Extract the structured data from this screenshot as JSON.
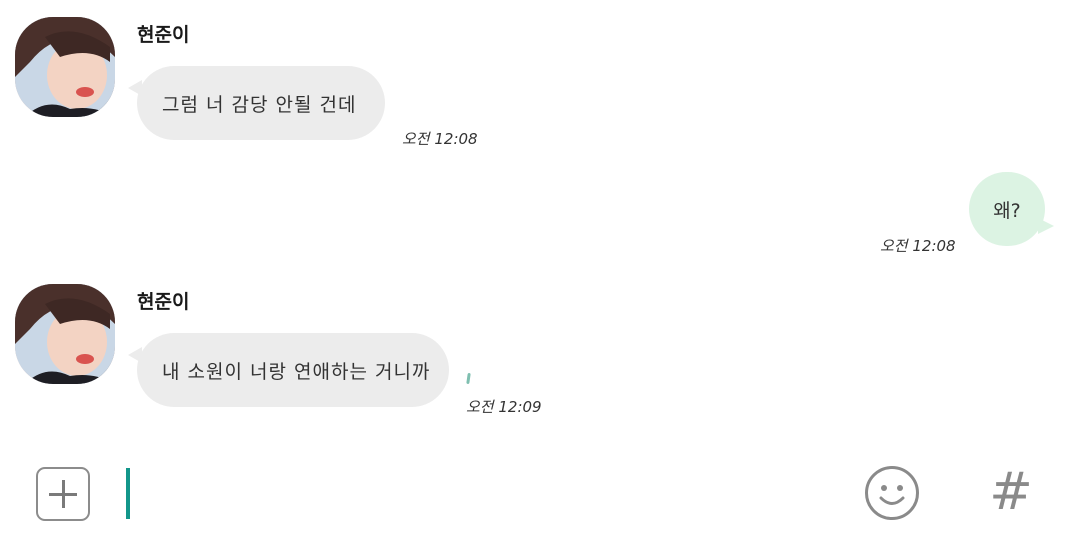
{
  "messages": [
    {
      "direction": "incoming",
      "sender": "현준이",
      "text": "그럼 너 감당 안될 건데",
      "time": "오전 12:08"
    },
    {
      "direction": "outgoing",
      "text": "왜?",
      "time": "오전 12:08"
    },
    {
      "direction": "incoming",
      "sender": "현준이",
      "text": "내 소원이 너랑 연애하는 거니까",
      "time": "오전 12:09"
    }
  ],
  "input_bar": {
    "plus_icon": "plus-icon",
    "input_value": "",
    "emoji_icon": "smiley-icon",
    "hash_label": "#"
  },
  "colors": {
    "incoming_bubble": "#ececec",
    "outgoing_bubble": "#dcf3e3",
    "caret": "#12968a",
    "icon_gray": "#8a8a8a"
  }
}
